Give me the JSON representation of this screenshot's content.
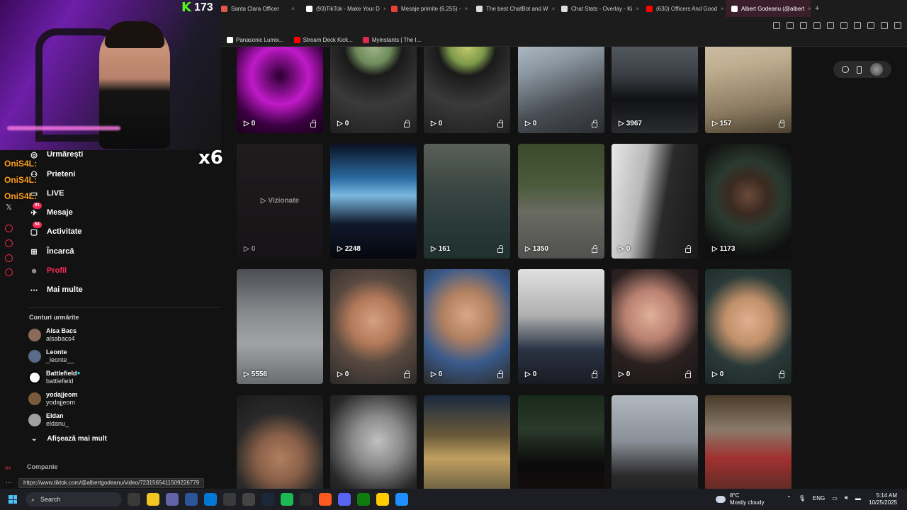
{
  "browser": {
    "tabs": [
      {
        "label": "Santa Clara Officer",
        "color": "#e05a4a"
      },
      {
        "label": "(93)TikTok - Make Your D",
        "color": "#ffffff"
      },
      {
        "label": "Mesaje primite (6.255) - ",
        "color": "#ea4335"
      },
      {
        "label": "The best ChatBot and W",
        "color": "#dddddd"
      },
      {
        "label": "Chat Stats - Overlay - Ki",
        "color": "#dddddd"
      },
      {
        "label": "(630) Officers And Good",
        "color": "#ff0000"
      },
      {
        "label": "Albert Godeanu (@albert",
        "color": "#ffffff",
        "active": true
      }
    ],
    "new_tab": "+",
    "bookmarks": [
      {
        "label": "Panasonic Lumix...",
        "color": "#ffffff"
      },
      {
        "label": "Stream Deck Kick...",
        "color": "#ff0000"
      },
      {
        "label": "Myinstants | The I...",
        "color": "#e0294a"
      }
    ],
    "status_url": "https://www.tiktok.com/@albertgodeanu/video/7231565411509226779"
  },
  "overlay": {
    "kick_logo": "K",
    "kick_count": "173",
    "multiplier": "x6",
    "chat_names": [
      "OniS4L:",
      "OniS4L:",
      "OniS4L:"
    ]
  },
  "sidebar": {
    "nav": [
      {
        "label": "Urmărești",
        "icon": "following-icon"
      },
      {
        "label": "Prieteni",
        "icon": "friends-icon"
      },
      {
        "label": "LIVE",
        "icon": "live-icon"
      },
      {
        "label": "Mesaje",
        "icon": "messages-icon",
        "badge": "91"
      },
      {
        "label": "Activitate",
        "icon": "activity-icon",
        "badge": "54"
      },
      {
        "label": "Încarcă",
        "icon": "upload-icon"
      },
      {
        "label": "Profil",
        "icon": "profile-avatar",
        "active": true
      },
      {
        "label": "Mai multe",
        "icon": "more-icon"
      }
    ],
    "following_title": "Conturi urmărite",
    "following": [
      {
        "name": "Alsa Bacs",
        "username": "alsabacs4",
        "color": "#8a6a5a"
      },
      {
        "name": "Leonte",
        "username": "_leonte__",
        "color": "#5a6a8a"
      },
      {
        "name": "Battlefield",
        "username": "battlefield",
        "color": "#ffffff",
        "verified": true
      },
      {
        "name": "yodajjeom",
        "username": "yodajjeom",
        "color": "#7a5a3a"
      },
      {
        "name": "Eldan",
        "username": "eldanu_",
        "color": "#a0a0a0"
      }
    ],
    "see_more": "Afișează mai mult",
    "company": "Companie"
  },
  "videos": [
    {
      "views": "0",
      "locked": true,
      "bg": "radial-gradient(circle at 50% 50%, #2a0030 0%, #c01ac8 40%, #3a0040 70%, #1a001a 100%)"
    },
    {
      "views": "0",
      "locked": true,
      "bg": "radial-gradient(circle at 50% 25%, #9fb38a 0%, #6e8a5a 18%, #1a1a1a 30%, #3a3a3a 60%, #202020 100%)"
    },
    {
      "views": "0",
      "locked": true,
      "bg": "radial-gradient(circle at 50% 25%, #c4c96a 0%, #7d9a4a 18%, #1a1a1a 30%, #3a3a3a 60%, #202020 100%)"
    },
    {
      "views": "0",
      "locked": true,
      "bg": "linear-gradient(160deg, #c9d6e0 0%, #8a96a0 40%, #4a4f55 70%, #2a2c30 100%)"
    },
    {
      "views": "3967",
      "locked": false,
      "bg": "linear-gradient(180deg, #6a7078 0%, #3a3e44 50%, #101214 70%, #2a2c30 100%)"
    },
    {
      "views": "157",
      "locked": true,
      "bg": "linear-gradient(170deg, #d8cdb8 0%, #bfae90 40%, #8a7a60 75%, #4a4030 100%)"
    },
    {
      "views": "0",
      "locked": false,
      "center_label": "Vizionate",
      "dim": true,
      "bg": "linear-gradient(180deg, #2a2428 0%, #1a161a 100%)"
    },
    {
      "views": "2248",
      "locked": false,
      "bg": "linear-gradient(180deg, #0a1020 0%, #2a6aa0 30%, #7ab8e0 45%, #10182a 70%, #05070d 100%)"
    },
    {
      "views": "161",
      "locked": true,
      "bg": "linear-gradient(180deg, #5a6058 0%, #3a4642 40%, #2a3a38 70%, #20302e 100%)"
    },
    {
      "views": "1350",
      "locked": true,
      "bg": "linear-gradient(180deg, #3a4a2a 0%, #4a5a3a 35%, #6a6a62 60%, #505050 100%)"
    },
    {
      "views": "0",
      "locked": true,
      "bg": "linear-gradient(100deg, #e8e8e8 0%, #b8b8b8 35%, #2a2a2a 60%, #1a1a1a 100%)"
    },
    {
      "views": "1173",
      "locked": false,
      "bg": "radial-gradient(circle at 50% 45%, #6a4a3a 0%, #3a2a20 25%, #2a3a30 45%, #101010 80%)"
    },
    {
      "views": "5556",
      "locked": false,
      "bg": "linear-gradient(180deg, #4a4e52 0%, #8a8c90 40%, #a0a2a6 65%, #6a6c70 100%)"
    },
    {
      "views": "0",
      "locked": true,
      "bg": "radial-gradient(circle at 50% 45%, #d4a080 0%, #b47a5a 30%, #5a4a40 55%, #2a2a2a 100%)"
    },
    {
      "views": "0",
      "locked": true,
      "bg": "radial-gradient(circle at 50% 40%, #d8a888 0%, #b08060 30%, #3a5a8a 60%, #2a2a2a 100%)"
    },
    {
      "views": "0",
      "locked": true,
      "bg": "linear-gradient(180deg, #e0e0e0 0%, #b0b0b0 40%, #2a3444 70%, #1a1a22 100%)"
    },
    {
      "views": "0",
      "locked": true,
      "bg": "radial-gradient(circle at 45% 40%, #e0b098 0%, #b88070 30%, #2a2020 60%, #1a1616 100%)"
    },
    {
      "views": "0",
      "locked": true,
      "bg": "radial-gradient(circle at 50% 45%, #e0b090 0%, #c0906a 30%, #2a3a38 60%, #1a2624 100%)"
    },
    {
      "views": "",
      "locked": false,
      "bg": "radial-gradient(circle at 50% 55%, #b08060 0%, #8a6048 30%, #2a2a2a 60%, #1a1a1a 100%)"
    },
    {
      "views": "",
      "locked": false,
      "bg": "radial-gradient(circle at 55% 40%, #c0c0c0 0%, #8a8a8a 30%, #2a2a2a 65%, #101010 100%)"
    },
    {
      "views": "",
      "locked": false,
      "bg": "linear-gradient(180deg, #1a2a40 0%, #6a5a3a 35%, #c0a060 55%, #3a3a30 100%)"
    },
    {
      "views": "",
      "locked": false,
      "bg": "linear-gradient(180deg, #1a2a1a 0%, #2a3a2a 30%, #0a0a0a 60%, #1a1010 100%)"
    },
    {
      "views": "",
      "locked": false,
      "bg": "linear-gradient(180deg, #b0b8c0 0%, #8a9098 40%, #2a2a2a 70%, #1a1a1a 100%)"
    },
    {
      "views": "",
      "locked": false,
      "bg": "linear-gradient(180deg, #4a3a2a 0%, #8a7a6a 30%, #a03030 55%, #3a2a20 100%)"
    }
  ],
  "taskbar": {
    "search_label": "Search",
    "weather_temp": "8°C",
    "weather_desc": "Mostly cloudy",
    "language": "ENG",
    "time": "5:14 AM",
    "date": "10/25/2025"
  }
}
